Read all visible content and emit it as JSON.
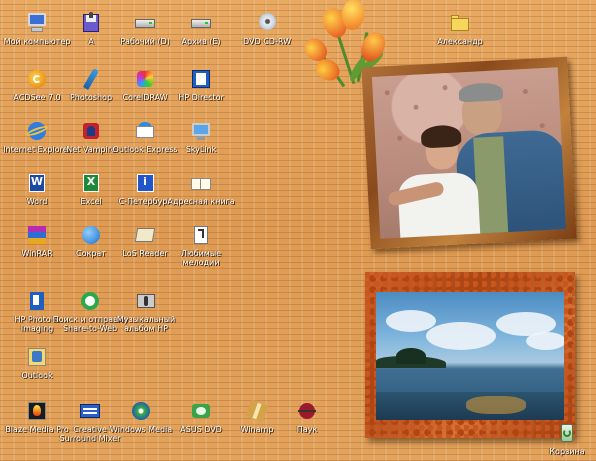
{
  "desktop": {
    "icons": [
      {
        "label": "Мой компьютер",
        "icon": "my-computer-icon"
      },
      {
        "label": "A",
        "icon": "floppy-drive-icon"
      },
      {
        "label": "Рабочий (D)",
        "icon": "hard-drive-icon"
      },
      {
        "label": "Архив (E)",
        "icon": "hard-drive-icon"
      },
      {
        "label": "DVD CD-RW",
        "icon": "cd-drive-icon"
      },
      {
        "label": "Александр",
        "icon": "folder-icon"
      },
      {
        "label": "ACDSee 7.0",
        "icon": "acdsee-icon"
      },
      {
        "label": "Photoshop",
        "icon": "photoshop-feather-icon"
      },
      {
        "label": "CorelDRAW",
        "icon": "coreldraw-icon"
      },
      {
        "label": "HP Director",
        "icon": "hp-director-icon"
      },
      {
        "label": "Internet Explorer",
        "icon": "internet-explorer-icon"
      },
      {
        "label": "Net Vampire",
        "icon": "net-vampire-icon"
      },
      {
        "label": "Outlook Express",
        "icon": "outlook-express-icon"
      },
      {
        "label": "SkyLink",
        "icon": "skylink-icon"
      },
      {
        "label": "Word",
        "icon": "word-icon"
      },
      {
        "label": "Excel",
        "icon": "excel-icon"
      },
      {
        "label": "С-Петербург",
        "icon": "info-icon"
      },
      {
        "label": "Адресная книга",
        "icon": "address-book-icon"
      },
      {
        "label": "WinRAR",
        "icon": "winrar-icon"
      },
      {
        "label": "Сократ",
        "icon": "globe-icon"
      },
      {
        "label": "LoS Reader",
        "icon": "reader-icon"
      },
      {
        "label": "Любимые\nмелодии",
        "icon": "music-file-icon"
      },
      {
        "label": "HP Photo &\nImaging",
        "icon": "hp-imaging-icon"
      },
      {
        "label": "Поиск и отправка\nShare-to-Web",
        "icon": "share-to-web-icon"
      },
      {
        "label": "Музыкальный\nальбом HP",
        "icon": "music-album-icon"
      },
      {
        "label": "Outlook",
        "icon": "outlook-icon"
      },
      {
        "label": "Blaze Media Pro",
        "icon": "blaze-media-icon"
      },
      {
        "label": "Creative\nSurround Mixer",
        "icon": "creative-mixer-icon"
      },
      {
        "label": "Windows Media",
        "icon": "windows-media-icon"
      },
      {
        "label": "ASUS DVD",
        "icon": "asus-dvd-icon"
      },
      {
        "label": "Winamp",
        "icon": "winamp-icon"
      },
      {
        "label": "Паук",
        "icon": "spider-solitaire-icon"
      },
      {
        "label": "Корзина",
        "icon": "recycle-bin-icon"
      }
    ]
  }
}
